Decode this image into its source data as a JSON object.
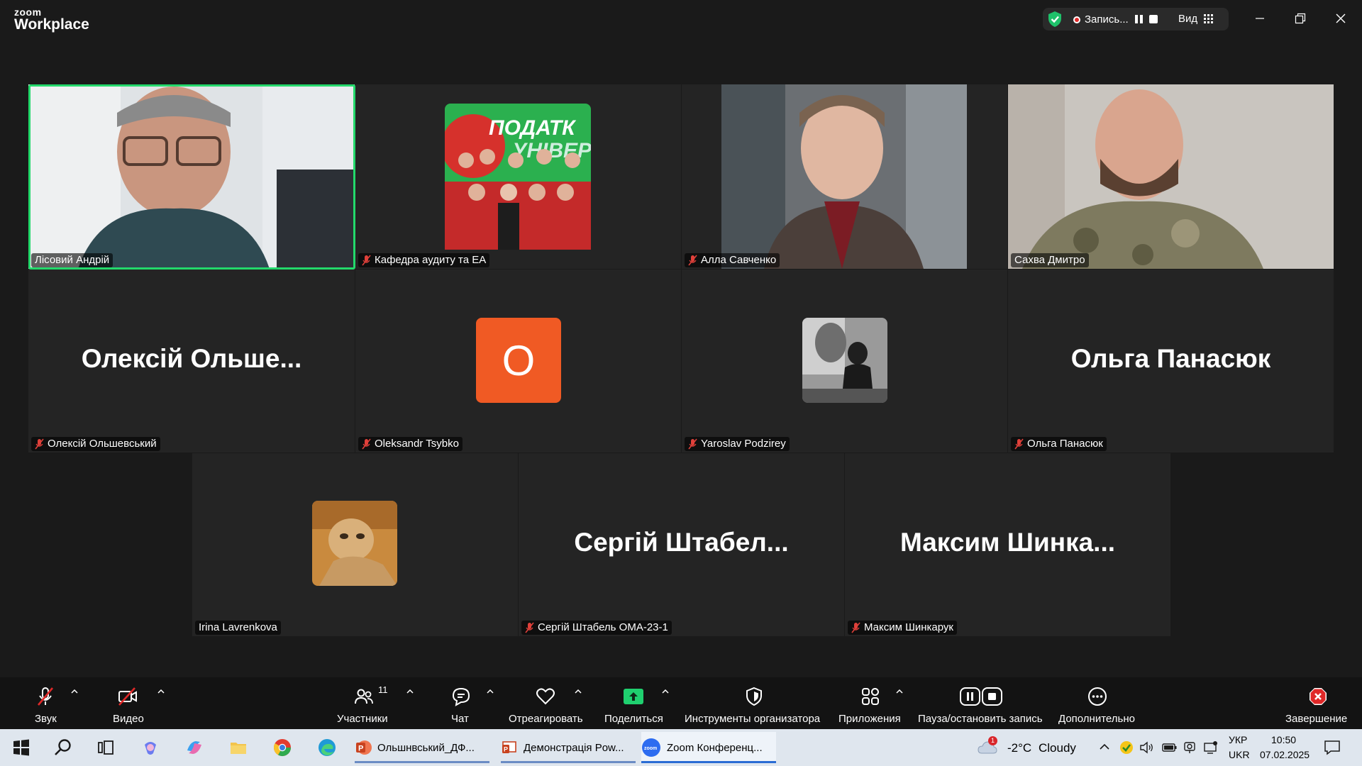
{
  "app": {
    "brand_small": "zoom",
    "brand_big": "Workplace"
  },
  "recording": {
    "label": "Запись...",
    "view_label": "Вид"
  },
  "tiles": [
    {
      "name": "Лісовий Андрій",
      "muted": false,
      "active": true
    },
    {
      "name": "Кафедра аудиту та ЕА",
      "muted": true,
      "poster_text": "ПОДАТК\nУНІВЕР"
    },
    {
      "name": "Алла Савченко",
      "muted": true
    },
    {
      "name": "Сахва Дмитро",
      "muted": false
    },
    {
      "name": "Олексій Ольшевський",
      "muted": true,
      "display": "Олексій  Ольше..."
    },
    {
      "name": "Oleksandr Tsybko",
      "muted": true,
      "avatar_letter": "O"
    },
    {
      "name": "Yaroslav Podzirey",
      "muted": true
    },
    {
      "name": "Ольга Панасюк",
      "muted": true,
      "display": "Ольга  Панасюк"
    },
    {
      "name": "Irina Lavrenkova",
      "muted": false
    },
    {
      "name": "Сергій Штабель ОМА-23-1",
      "muted": true,
      "display": "Сергій  Штабел..."
    },
    {
      "name": "Максим Шинкарук",
      "muted": true,
      "display": "Максим  Шинка..."
    }
  ],
  "toolbar": {
    "audio": "Звук",
    "video": "Видео",
    "participants": "Участники",
    "participants_count": "11",
    "chat": "Чат",
    "react": "Отреагировать",
    "share": "Поделиться",
    "host_tools": "Инструменты организатора",
    "apps": "Приложения",
    "pause_record": "Пауза/остановить запись",
    "more": "Дополнительно",
    "end": "Завершение"
  },
  "taskbar": {
    "apps": [
      {
        "label": "Ольшнвський_ДФ...",
        "icon": "powerpoint-icon"
      },
      {
        "label": "Демонстрація Pow...",
        "icon": "powerpoint-slideshow-icon"
      },
      {
        "label": "Zoom Конференц...",
        "icon": "zoom-icon"
      }
    ],
    "weather_temp": "-2°C",
    "weather_desc": "Cloudy",
    "weather_badge": "1",
    "lang_top": "УКР",
    "lang_bottom": "UKR",
    "time": "10:50",
    "date": "07.02.2025"
  },
  "colors": {
    "active_border": "#23d96b",
    "muted_red": "#e0403a",
    "share_green": "#1fd06f",
    "end_red": "#e02828",
    "avatar_orange": "#f05a24"
  }
}
